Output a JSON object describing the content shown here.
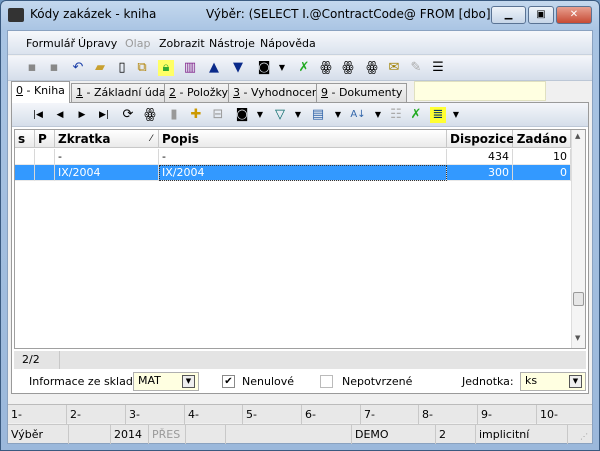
{
  "window": {
    "title": "Kódy zakázek - kniha",
    "subtitle": "Výběr: (SELECT I.@ContractCode@ FROM [dbo].[IN...",
    "logo": "K2"
  },
  "menu": [
    {
      "label": "Formulář"
    },
    {
      "label": "Úpravy"
    },
    {
      "label": "Olap",
      "disabled": true
    },
    {
      "label": "Zobrazit"
    },
    {
      "label": "Nástroje"
    },
    {
      "label": "Nápověda"
    }
  ],
  "tabs": [
    {
      "key": "0",
      "label": " - Kniha"
    },
    {
      "key": "1",
      "label": " - Základní údaje"
    },
    {
      "key": "2",
      "label": " - Položky"
    },
    {
      "key": "3",
      "label": " - Vyhodnocení"
    },
    {
      "key": "9",
      "label": " - Dokumenty"
    }
  ],
  "grid": {
    "columns": [
      "s",
      "P",
      "Zkratka",
      "Popis",
      "Dispozice",
      "Zadáno"
    ],
    "sort_marker": "⁄",
    "rows": [
      {
        "s": "",
        "p": "",
        "zkratka": "-",
        "popis": "-",
        "dispozice": "434",
        "zadano": "10"
      },
      {
        "s": "",
        "p": "",
        "zkratka": "IX/2004",
        "popis": "IX/2004",
        "dispozice": "300",
        "zadano": "0",
        "selected": true
      }
    ]
  },
  "record_count": "2/2",
  "options": {
    "sklad_label": "Informace ze skladu:",
    "sklad_value": "MAT",
    "nenulove_label": "Nenulové",
    "nenulove_checked": true,
    "nepotvrzene_label": "Nepotvrzené",
    "nepotvrzene_checked": false,
    "jednotka_label": "Jednotka:",
    "jednotka_value": "ks"
  },
  "fkeys": [
    "1-",
    "2-",
    "3-",
    "4-",
    "5-",
    "6-",
    "7-",
    "8-",
    "9-",
    "10-"
  ],
  "status": [
    "Výběr",
    "",
    "2014",
    "PŘES",
    "",
    "",
    "DEMO",
    "2",
    "implicitní"
  ]
}
